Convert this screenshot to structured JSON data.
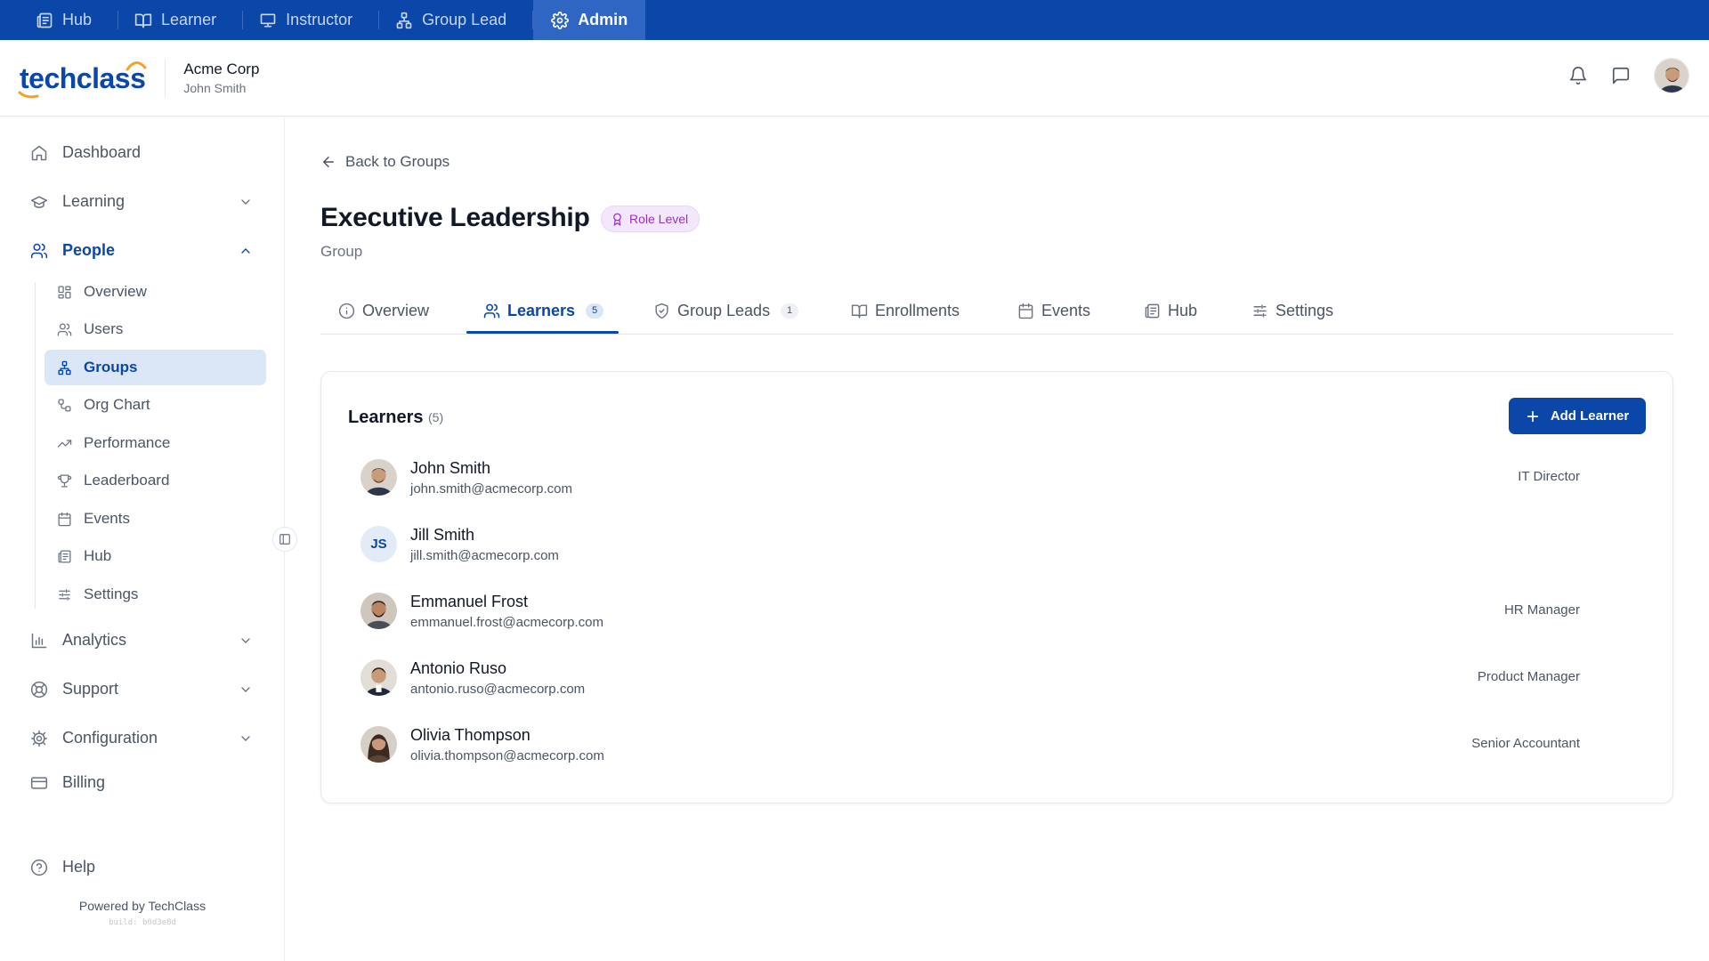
{
  "topbar": {
    "tabs": [
      {
        "label": "Hub",
        "icon": "newspaper-icon"
      },
      {
        "label": "Learner",
        "icon": "book-open-icon"
      },
      {
        "label": "Instructor",
        "icon": "presentation-icon"
      },
      {
        "label": "Group Lead",
        "icon": "network-icon"
      },
      {
        "label": "Admin",
        "icon": "gear-icon",
        "active": true
      }
    ]
  },
  "header": {
    "logo_text": "techclass",
    "company": "Acme Corp",
    "user": "John Smith"
  },
  "sidebar": {
    "dashboard": "Dashboard",
    "learning": "Learning",
    "people": "People",
    "people_items": [
      "Overview",
      "Users",
      "Groups",
      "Org Chart",
      "Performance",
      "Leaderboard",
      "Events",
      "Hub",
      "Settings"
    ],
    "active_item": "Groups",
    "analytics": "Analytics",
    "support": "Support",
    "configuration": "Configuration",
    "billing": "Billing",
    "help": "Help",
    "powered_by": "Powered by TechClass",
    "build": "build: b0d3e8d"
  },
  "main": {
    "back_label": "Back to Groups",
    "title": "Executive Leadership",
    "badge": "Role Level",
    "subtitle": "Group",
    "tabs": [
      {
        "label": "Overview"
      },
      {
        "label": "Learners",
        "count": "5",
        "active": true
      },
      {
        "label": "Group Leads",
        "count": "1"
      },
      {
        "label": "Enrollments"
      },
      {
        "label": "Events"
      },
      {
        "label": "Hub"
      },
      {
        "label": "Settings"
      }
    ],
    "card": {
      "title": "Learners",
      "count": "(5)",
      "add_button": "Add Learner",
      "learners": [
        {
          "name": "John Smith",
          "email": "john.smith@acmecorp.com",
          "role": "IT Director",
          "avatar": "photo"
        },
        {
          "name": "Jill Smith",
          "email": "jill.smith@acmecorp.com",
          "role": "",
          "avatar": "initials",
          "initials": "JS"
        },
        {
          "name": "Emmanuel Frost",
          "email": "emmanuel.frost@acmecorp.com",
          "role": "HR Manager",
          "avatar": "photo"
        },
        {
          "name": "Antonio Ruso",
          "email": "antonio.ruso@acmecorp.com",
          "role": "Product Manager",
          "avatar": "photo"
        },
        {
          "name": "Olivia Thompson",
          "email": "olivia.thompson@acmecorp.com",
          "role": "Senior Accountant",
          "avatar": "photo"
        }
      ]
    }
  },
  "colors": {
    "brand": "#0a47a9",
    "accent_orange": "#f4a223",
    "badge_purple": "#a02cc6",
    "active_bg": "#dbe6f7"
  }
}
